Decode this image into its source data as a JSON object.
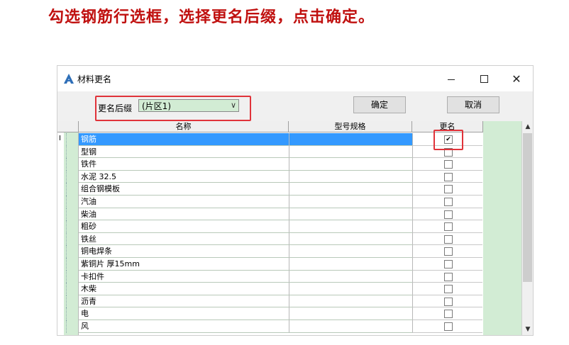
{
  "instruction": "勾选钢筋行选框，选择更名后缀，点击确定。",
  "window": {
    "title": "材料更名",
    "app_icon": "app-logo-icon",
    "controls": {
      "minimize": "minimize-icon",
      "maximize": "maximize-icon",
      "close": "close-icon",
      "close_glyph": "✕"
    }
  },
  "toolbar": {
    "suffix_label": "更名后缀",
    "suffix_value": "(片区1)",
    "dropdown_glyph": "∨",
    "ok_label": "确定",
    "cancel_label": "取消"
  },
  "grid": {
    "headers": [
      "名称",
      "型号规格",
      "更名"
    ],
    "current_row_marker": "I",
    "rows": [
      {
        "name": "钢筋",
        "spec": "",
        "rename": true,
        "selected": true
      },
      {
        "name": "型钢",
        "spec": "",
        "rename": false
      },
      {
        "name": "铁件",
        "spec": "",
        "rename": false
      },
      {
        "name": "水泥 32.5",
        "spec": "",
        "rename": false
      },
      {
        "name": "组合钢模板",
        "spec": "",
        "rename": false
      },
      {
        "name": "汽油",
        "spec": "",
        "rename": false
      },
      {
        "name": "柴油",
        "spec": "",
        "rename": false
      },
      {
        "name": "粗砂",
        "spec": "",
        "rename": false
      },
      {
        "name": "铁丝",
        "spec": "",
        "rename": false
      },
      {
        "name": "铜电焊条",
        "spec": "",
        "rename": false
      },
      {
        "name": "紫铜片 厚15mm",
        "spec": "",
        "rename": false
      },
      {
        "name": "卡扣件",
        "spec": "",
        "rename": false
      },
      {
        "name": "木柴",
        "spec": "",
        "rename": false
      },
      {
        "name": "沥青",
        "spec": "",
        "rename": false
      },
      {
        "name": "电",
        "spec": "",
        "rename": false
      },
      {
        "name": "风",
        "spec": "",
        "rename": false
      }
    ]
  },
  "scrollbar": {
    "up_glyph": "▲",
    "down_glyph": "▼"
  },
  "colors": {
    "instruction": "#c0100f",
    "highlight_box": "#e0333a",
    "grid_green": "#d2ecd4",
    "selection": "#3399ff"
  }
}
